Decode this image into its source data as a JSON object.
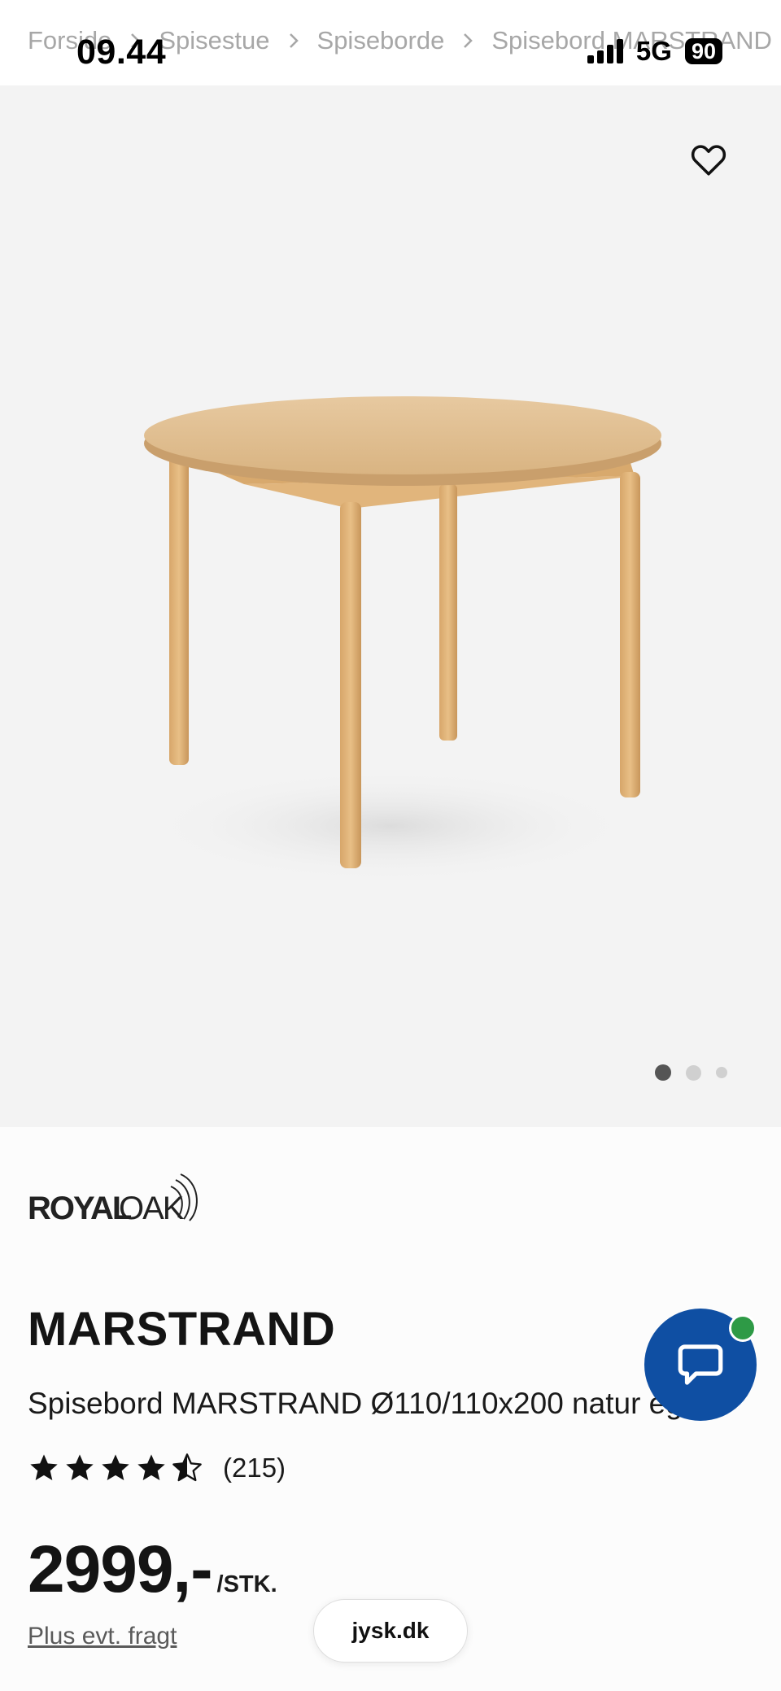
{
  "status_bar": {
    "time": "09.44",
    "network": "5G",
    "battery": "90"
  },
  "breadcrumb": {
    "items": [
      "Forside",
      "Spisestue",
      "Spiseborde",
      "Spisebord MARSTRAND"
    ],
    "separator_icon": "chevron-right-icon"
  },
  "gallery": {
    "favorite_icon": "heart-outline-icon",
    "image_alt": "Spisebord MARSTRAND round oak table",
    "dots_count": 3,
    "active_dot": 0
  },
  "product": {
    "brand_logo_text": "ROYAL OAK",
    "name": "MARSTRAND",
    "subtitle": "Spisebord MARSTRAND Ø110/110x200 natur eg",
    "rating_value": 4.5,
    "rating_max": 5,
    "review_count": "(215)",
    "price": "2999,-",
    "price_unit": "/STK.",
    "shipping_note": "Plus evt. fragt"
  },
  "chat": {
    "icon": "chat-bubble-icon",
    "status_color": "#2e9a46"
  },
  "browser": {
    "domain": "jysk.dk"
  },
  "colors": {
    "accent_blue": "#0f4fa3",
    "online_green": "#2e9a46",
    "gallery_bg": "#f3f3f3"
  }
}
